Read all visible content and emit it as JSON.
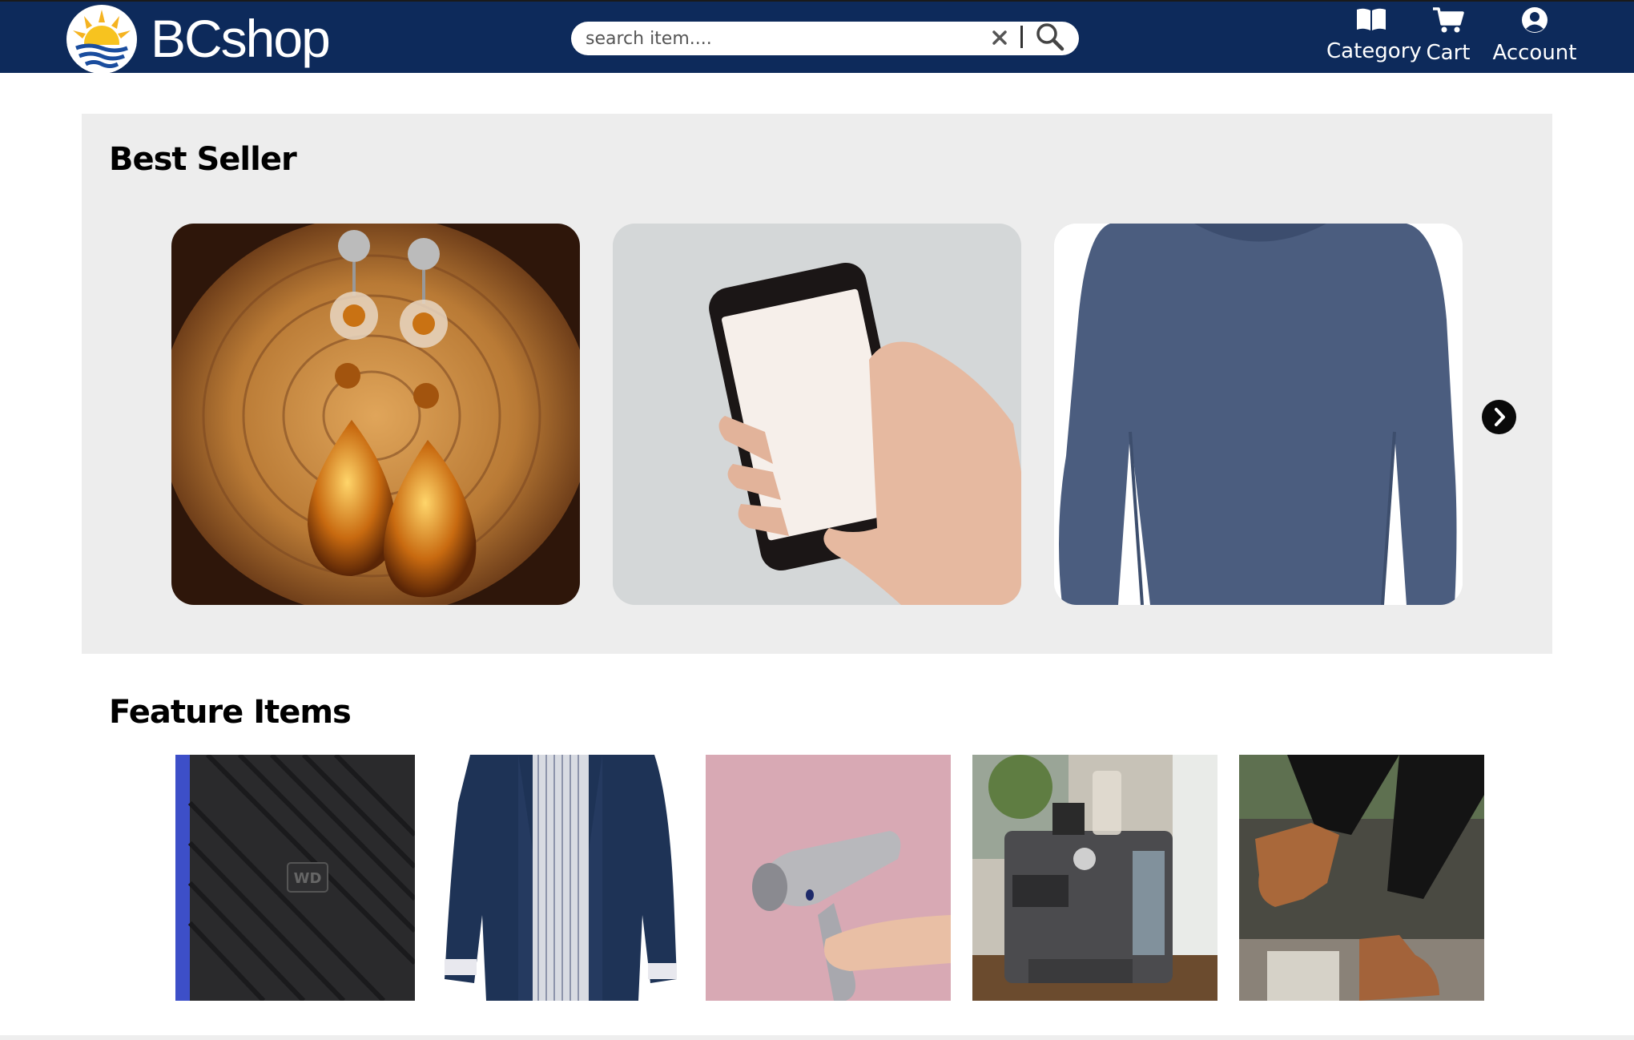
{
  "header": {
    "brand": "BCshop",
    "logo_icon": "sun-over-sea-logo",
    "background_color": "#0d2a5b",
    "search": {
      "placeholder": "search item....",
      "value": "",
      "clear_icon": "close-icon",
      "button_icon": "search-icon"
    },
    "nav": [
      {
        "label": "Category",
        "icon": "book-icon"
      },
      {
        "label": "Cart",
        "icon": "cart-icon"
      },
      {
        "label": "Account",
        "icon": "user-circle-icon"
      }
    ]
  },
  "best_seller": {
    "title": "Best Seller",
    "background_color": "#ededed",
    "items": [
      {
        "image": "amber-drop-earrings-photo"
      },
      {
        "image": "hand-holding-smartphone-photo"
      },
      {
        "image": "blue-long-sleeve-shirt-photo"
      }
    ],
    "next_icon": "chevron-right-icon"
  },
  "feature_items": {
    "title": "Feature Items",
    "items": [
      {
        "image": "external-hard-drive-photo"
      },
      {
        "image": "navy-jacket-photo"
      },
      {
        "image": "hair-dryer-photo"
      },
      {
        "image": "espresso-machine-photo"
      },
      {
        "image": "brown-ankle-boots-photo"
      }
    ]
  }
}
